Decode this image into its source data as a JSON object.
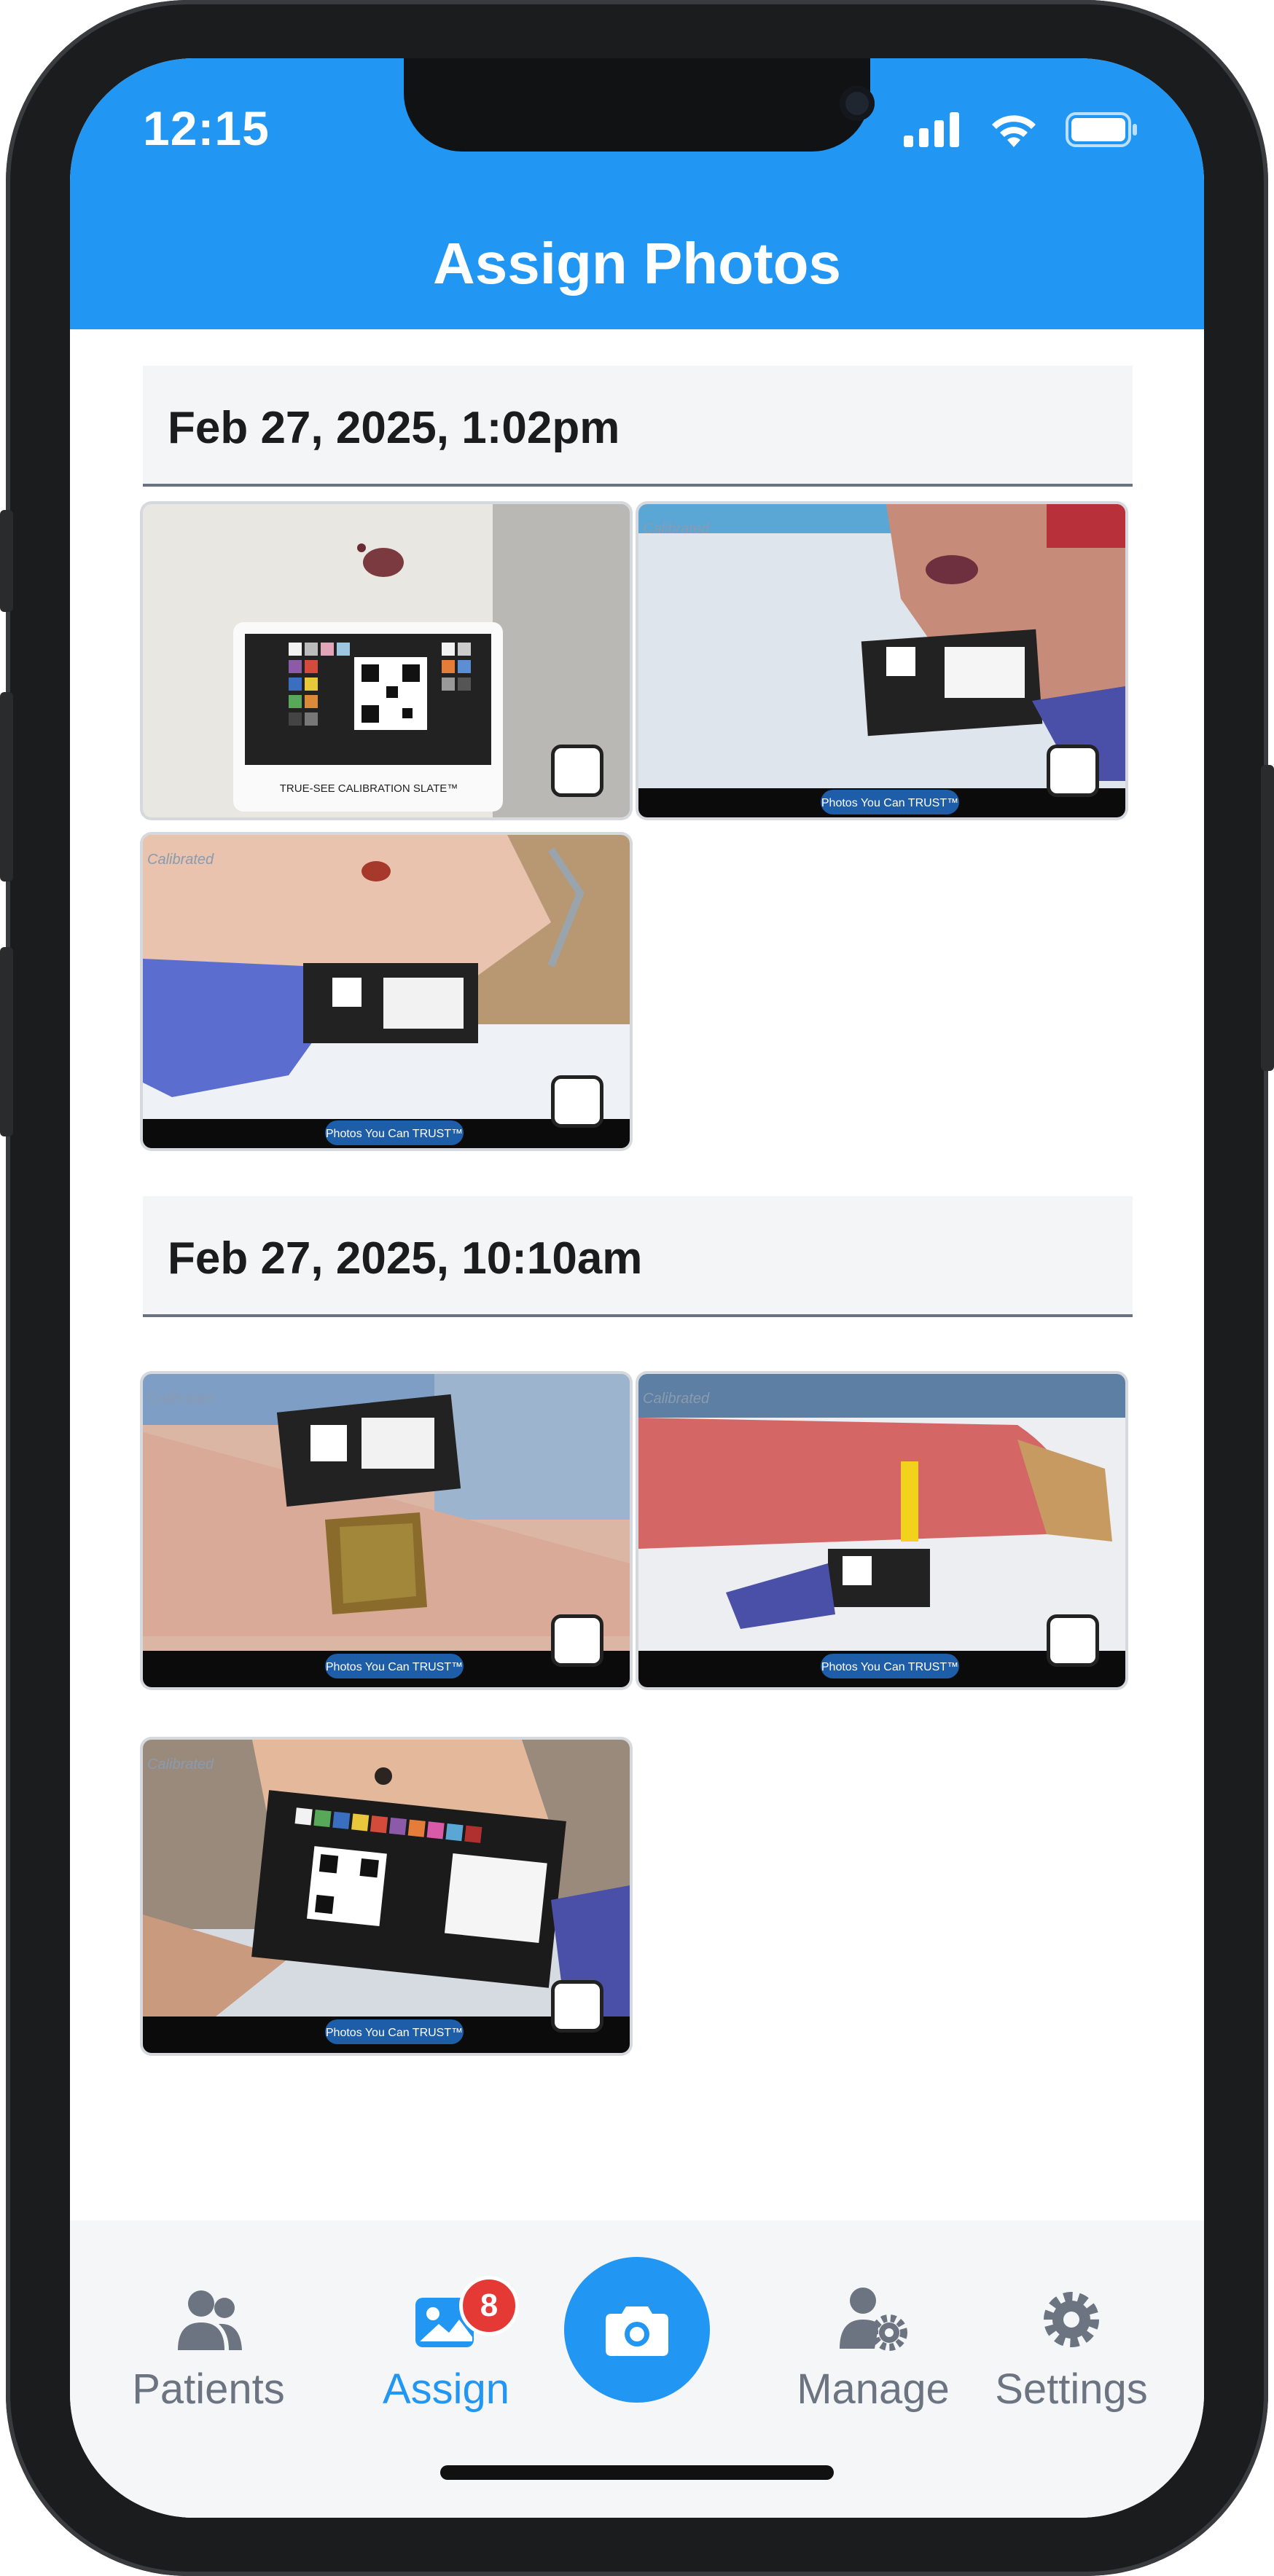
{
  "status": {
    "time": "12:15"
  },
  "header": {
    "title": "Assign Photos"
  },
  "sections": [
    {
      "label": "Feb 27, 2025, 1:02pm"
    },
    {
      "label": "Feb 27, 2025, 10:10am"
    }
  ],
  "photo_overlay": {
    "calibrated": "Calibrated",
    "trust": "Photos You Can TRUST™",
    "slate": "TRUE-SEE CALIBRATION SLATE™"
  },
  "tabs": {
    "patients": "Patients",
    "assign": "Assign",
    "assign_badge": "8",
    "manage": "Manage",
    "settings": "Settings"
  },
  "colors": {
    "accent": "#2196f3",
    "badge": "#e53935",
    "inactive": "#6b7480"
  }
}
